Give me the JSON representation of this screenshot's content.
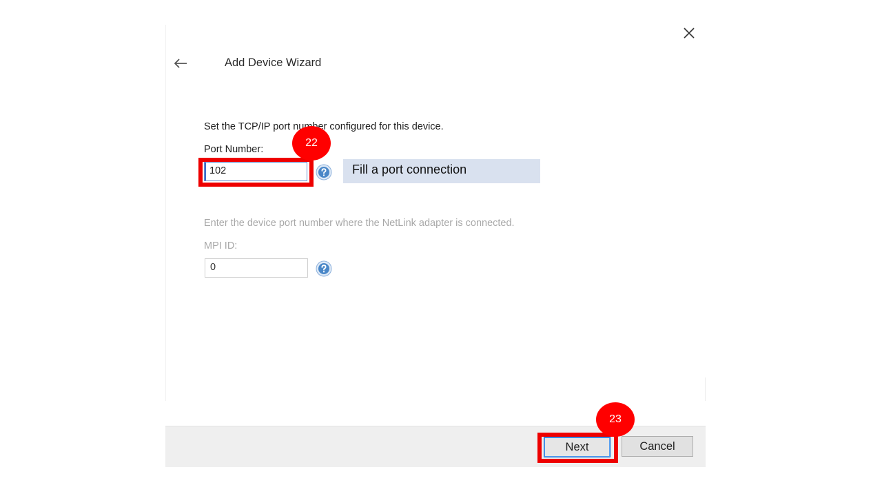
{
  "window": {
    "title": "Add Device Wizard"
  },
  "port_section": {
    "instruction": "Set the TCP/IP port number configured for this device.",
    "label": "Port Number:",
    "value": "102"
  },
  "mpi_section": {
    "instruction": "Enter the device port number where the NetLink adapter is connected.",
    "label": "MPI ID:",
    "value": "0"
  },
  "annotations": {
    "step_22": "22",
    "step_23": "23",
    "callout_text": "Fill a port connection",
    "highlight_color": "#ee0000",
    "callout_color": "#d9e1ef"
  },
  "footer": {
    "next_label": "Next",
    "cancel_label": "Cancel"
  },
  "icons": {
    "close": "close-icon",
    "back": "back-arrow-icon",
    "help": "help-icon"
  },
  "colors": {
    "footer_bg": "#efefef",
    "focus_blue": "#0a67d2",
    "help_blue": "#4a87c8"
  }
}
